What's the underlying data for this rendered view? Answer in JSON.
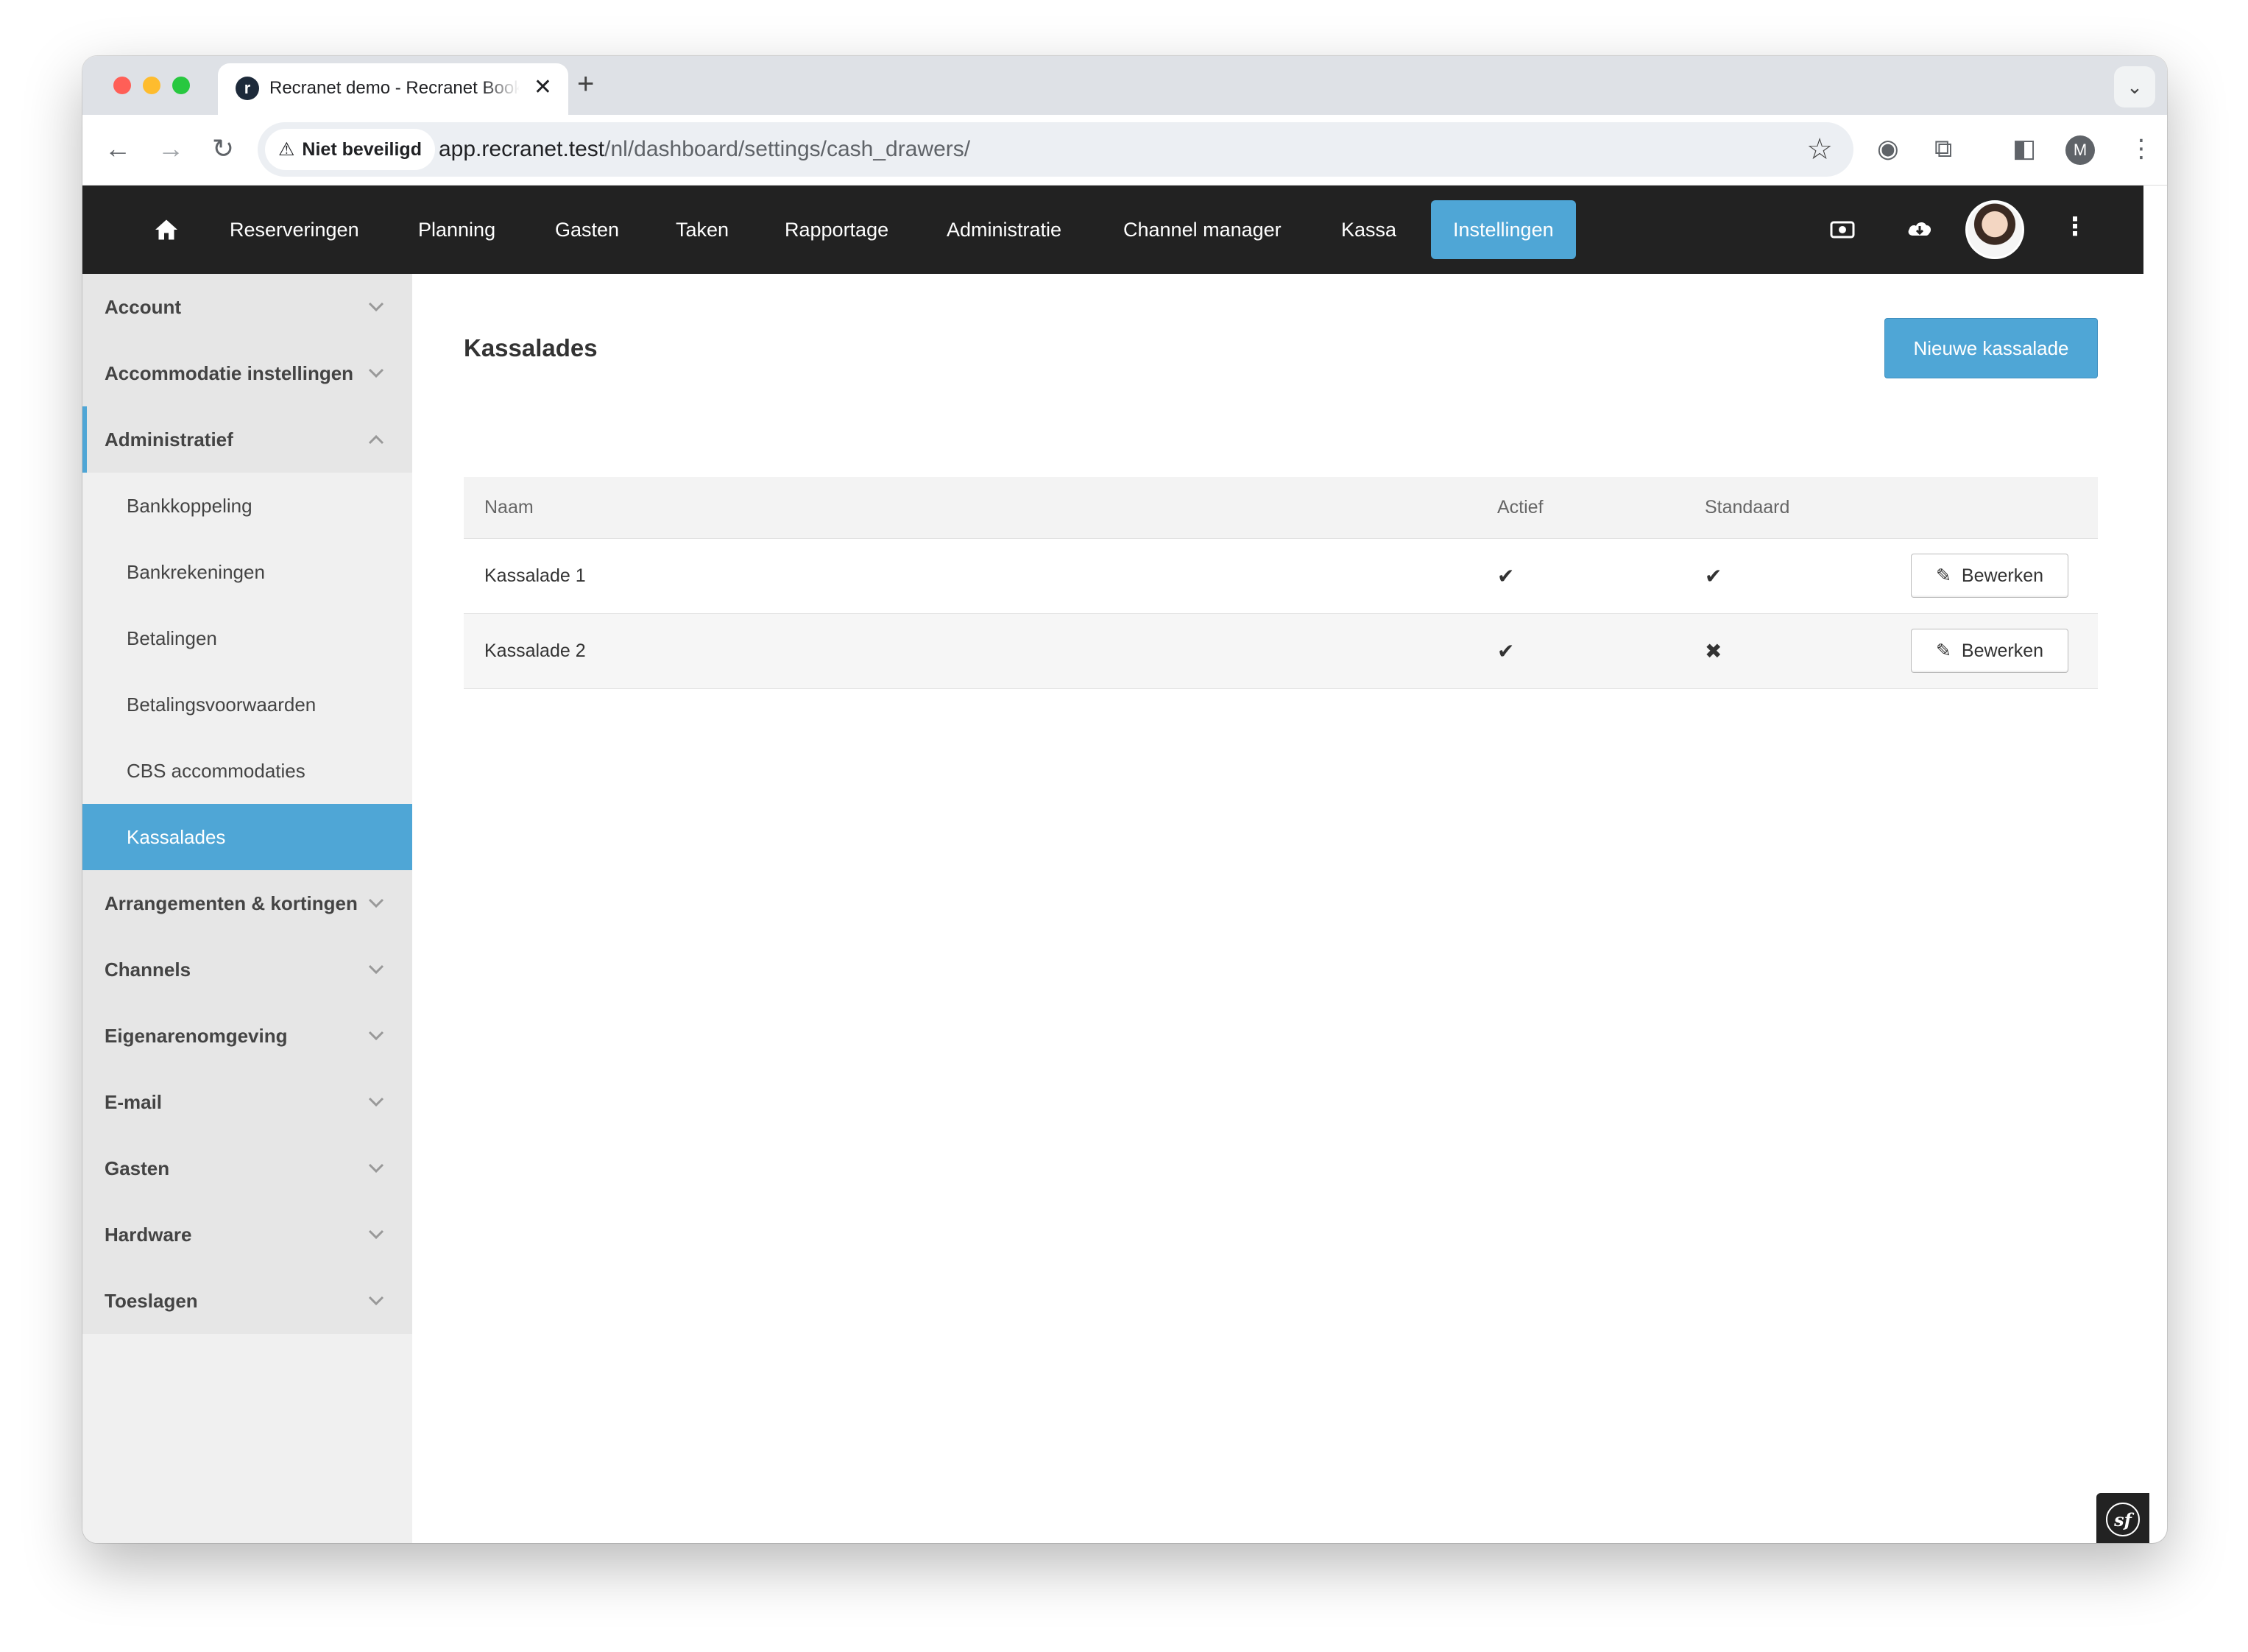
{
  "browser": {
    "tab_title": "Recranet demo - Recranet Booking",
    "tab_close": "✕",
    "new_tab": "+",
    "security_label": "Niet beveiligd",
    "url_host": "app.recranet.test",
    "url_path": "/nl/dashboard/settings/cash_drawers/",
    "profile_initial": "M"
  },
  "nav": {
    "items": [
      "Reserveringen",
      "Planning",
      "Gasten",
      "Taken",
      "Rapportage",
      "Administratie",
      "Channel manager",
      "Kassa",
      "Instellingen"
    ],
    "active": "Instellingen"
  },
  "sidebar": {
    "sections": [
      {
        "label": "Account"
      },
      {
        "label": "Accommodatie instellingen"
      },
      {
        "label": "Administratief",
        "open": true,
        "children": [
          "Bankkoppeling",
          "Bankrekeningen",
          "Betalingen",
          "Betalingsvoorwaarden",
          "CBS accommodaties",
          "Kassalades"
        ],
        "active_child": "Kassalades"
      },
      {
        "label": "Arrangementen & kortingen"
      },
      {
        "label": "Channels"
      },
      {
        "label": "Eigenarenomgeving"
      },
      {
        "label": "E-mail"
      },
      {
        "label": "Gasten"
      },
      {
        "label": "Hardware"
      },
      {
        "label": "Toeslagen"
      }
    ]
  },
  "main": {
    "title": "Kassalades",
    "new_button": "Nieuwe kassalade",
    "table": {
      "headers": {
        "name": "Naam",
        "active": "Actief",
        "default": "Standaard"
      },
      "edit_label": "Bewerken",
      "rows": [
        {
          "name": "Kassalade 1",
          "active": "✔",
          "default": "✔"
        },
        {
          "name": "Kassalade 2",
          "active": "✔",
          "default": "✖"
        }
      ]
    }
  },
  "colors": {
    "accent": "#4fa6d6",
    "navbar": "#222222",
    "sidebar": "#e6e6e6"
  }
}
